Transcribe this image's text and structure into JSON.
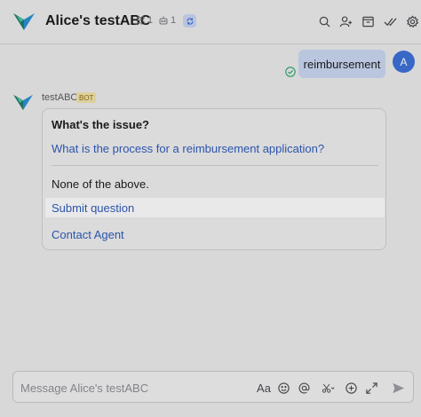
{
  "header": {
    "title": "Alice's testABC",
    "member_count": "1",
    "bot_count": "1"
  },
  "messages": {
    "user_text": "reimbursement",
    "user_avatar_initial": "A",
    "bot_name": "testABC",
    "bot_badge": "BOT"
  },
  "card": {
    "title": "What's the issue?",
    "faq_link": "What is the process for a reimbursement application?",
    "none_text": "None of the above.",
    "submit_label": "Submit question",
    "contact_label": "Contact Agent"
  },
  "input": {
    "placeholder": "Message Alice's testABC",
    "format_glyph": "Aa"
  },
  "colors": {
    "link": "#2f5bb8",
    "user_bubble": "#c9d5ef",
    "avatar": "#3d6fd6",
    "bot_badge_bg": "#efe0a8",
    "read_check": "#2aa36b"
  }
}
